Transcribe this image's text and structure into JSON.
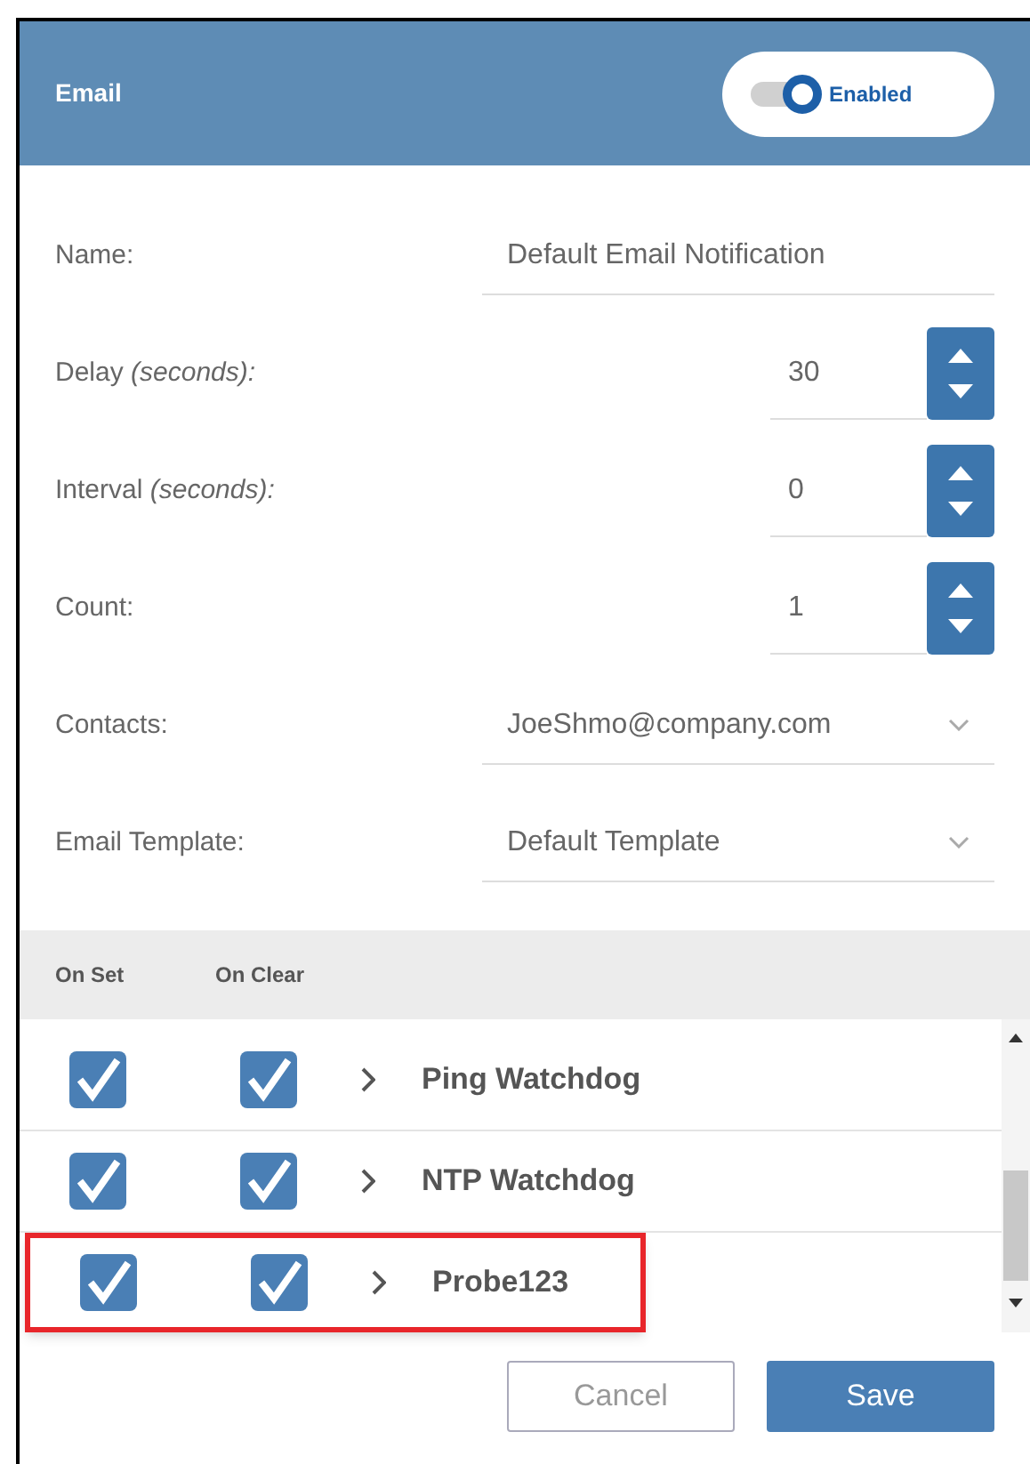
{
  "header": {
    "title": "Email",
    "toggle": {
      "label": "Enabled",
      "on": true
    }
  },
  "fields": [
    {
      "kind": "text",
      "label": "Name:",
      "value": "Default Email Notification"
    },
    {
      "kind": "spinner",
      "label": "Delay *(seconds):*",
      "value": "30"
    },
    {
      "kind": "spinner",
      "label": "Interval *(seconds):*",
      "value": "0"
    },
    {
      "kind": "spinner",
      "label": "Count:",
      "value": "1"
    },
    {
      "kind": "select",
      "label": "Contacts:",
      "value": "JoeShmo@company.com"
    },
    {
      "kind": "select",
      "label": "Email Template:",
      "value": "Default Template"
    }
  ],
  "list": {
    "columns": [
      "On Set",
      "On Clear"
    ],
    "rows": [
      {
        "on_set": true,
        "on_clear": true,
        "name": "Ping Watchdog",
        "highlighted": false
      },
      {
        "on_set": true,
        "on_clear": true,
        "name": "NTP Watchdog",
        "highlighted": false
      },
      {
        "on_set": true,
        "on_clear": true,
        "name": "Probe123",
        "highlighted": true
      }
    ]
  },
  "buttons": [
    {
      "kind": "secondary",
      "label": "Cancel"
    },
    {
      "kind": "primary",
      "label": "Save"
    }
  ]
}
